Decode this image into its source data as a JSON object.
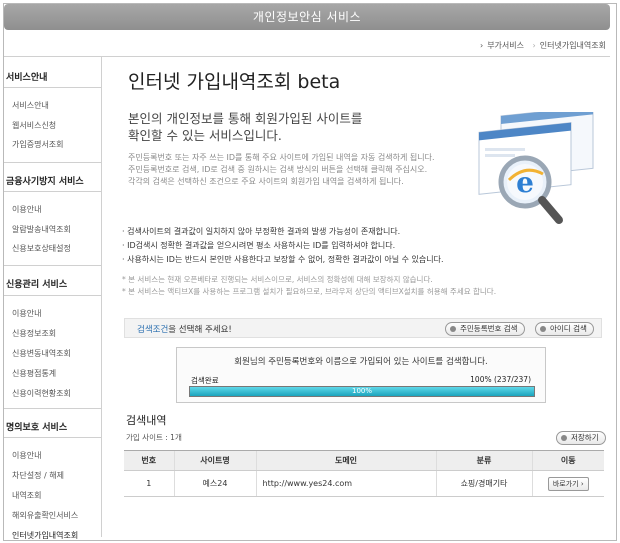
{
  "header": {
    "title": "개인정보안심 서비스"
  },
  "breadcrumb": {
    "items": [
      "부가서비스",
      "인터넷가입내역조회"
    ],
    "separator": "›"
  },
  "sidebar": {
    "sections": [
      {
        "title": "서비스안내",
        "items": [
          "서비스안내",
          "웹서비스신청",
          "가입증명서조회"
        ]
      },
      {
        "title": "금융사기방지 서비스",
        "items": [
          "이용안내",
          "알람발송내역조회",
          "신용보호상태설정"
        ]
      },
      {
        "title": "신용관리 서비스",
        "items": [
          "이용안내",
          "신용정보조회",
          "신용변동내역조회",
          "신용평점통계",
          "신용이력현황조회"
        ]
      },
      {
        "title": "명의보호 서비스",
        "items": [
          "이용안내",
          "차단설정 / 해제",
          "내역조회",
          "해외유출확인서비스",
          "인터넷가입내역조회"
        ]
      }
    ]
  },
  "main": {
    "title": "인터넷 가입내역조회 beta",
    "intro_line1": "본인의 개인정보를 통해 회원가입된 사이트를",
    "intro_line2": "확인할 수 있는 서비스입니다.",
    "desc_line1": "주민등록번호 또는 자주 쓰는 ID를 통해 주요 사이트에 가입된 내역을 자동 검색하게 됩니다.",
    "desc_line2": "주민등록번호로 검색, ID로 검색 중 원하시는 검색 방식의 버튼을 선택해 클릭해 주십시오.",
    "desc_line3": "각각의 검색은 선택하신 조건으로 주요 사이트의 회원가입 내역을 검색하게 됩니다.",
    "notes": [
      "· 검색사이트의 결과값이 일치하지 않아 부정확한 결과의 발생 가능성이 존재합니다.",
      "· ID검색시 정확한 결과값을 얻으시려면 평소 사용하시는 ID를 입력하셔야 합니다.",
      "· 사용하시는 ID는 반드시 본인만 사용한다고 보장할 수 없어, 정확한 결과값이 아닐 수 있습니다."
    ],
    "notes_gray": [
      "* 본 서비스는 현재 오픈베타로 진행되는 서비스이므로, 서비스의 정확성에 대해 보장하지 않습니다.",
      "* 본 서비스는 액티브X를 사용하는 프로그램 설치가 필요하므로, 브라우저 상단의 액티브X설치를 허용해 주세요 합니다."
    ],
    "search": {
      "label_highlight": "검색조건",
      "label_rest": "을 선택해 주세요!",
      "btn_ssn": "주민등록번호 검색",
      "btn_id": "아이디 검색"
    },
    "result": {
      "message": "회원님의 주민등록번호와 이름으로 가입되어 있는 사이트를 검색합니다.",
      "status": "검색완료",
      "progress_text": "100% (237/237)",
      "progress_value": 100,
      "bar_label": "100%"
    },
    "list": {
      "title": "검색내역",
      "count": "가입 사이트 : 1개",
      "save_label": "저장하기",
      "columns": [
        "번호",
        "사이트명",
        "도메인",
        "분류",
        "이동"
      ],
      "rows": [
        {
          "no": "1",
          "site": "예스24",
          "domain": "http://www.yes24.com",
          "category": "쇼핑/경매기타",
          "action": "바로가기 ›"
        }
      ]
    }
  }
}
